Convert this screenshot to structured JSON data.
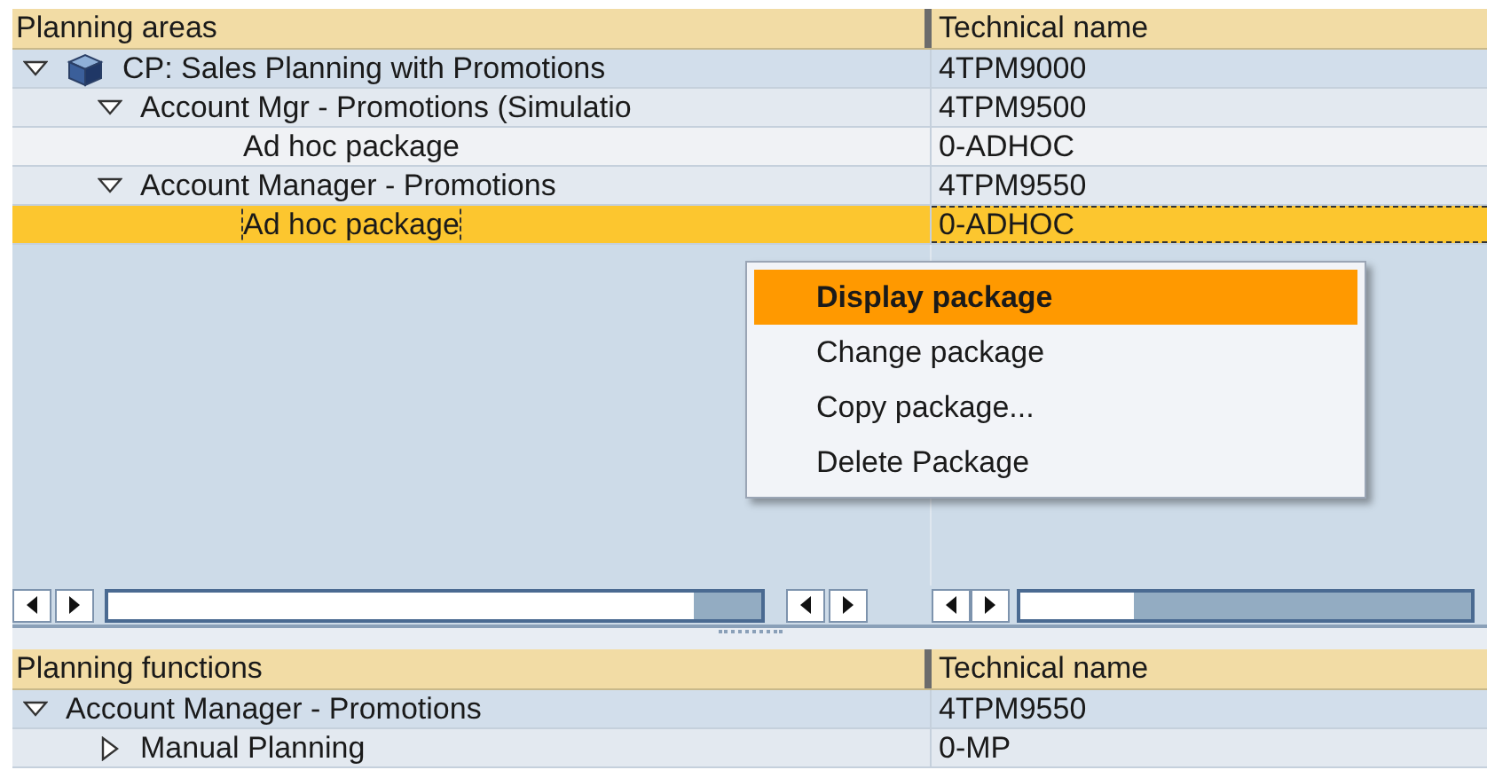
{
  "areas_table": {
    "columns": [
      "Planning areas",
      "Technical name"
    ],
    "rows": [
      {
        "kind": "area",
        "label": "CP: Sales Planning with Promotions",
        "technical_name": "4TPM9000",
        "expanded": true,
        "selected": false,
        "children": [
          {
            "kind": "level",
            "label": "Account Mgr - Promotions (Simulatio",
            "technical_name": "4TPM9500",
            "expanded": true,
            "selected": false,
            "children": [
              {
                "kind": "package",
                "label": "Ad hoc package",
                "technical_name": "0-ADHOC",
                "selected": false
              }
            ]
          },
          {
            "kind": "level",
            "label": "Account Manager - Promotions",
            "technical_name": "4TPM9550",
            "expanded": true,
            "selected": false,
            "children": [
              {
                "kind": "package",
                "label": "Ad hoc package",
                "technical_name": "0-ADHOC",
                "selected": true
              }
            ]
          }
        ]
      }
    ]
  },
  "context_menu": [
    {
      "label": "Display package",
      "selected": true
    },
    {
      "label": "Change package",
      "selected": false
    },
    {
      "label": "Copy package...",
      "selected": false
    },
    {
      "label": "Delete Package",
      "selected": false
    }
  ],
  "functions_table": {
    "columns": [
      "Planning functions",
      "Technical name"
    ],
    "rows": [
      {
        "kind": "level",
        "label": "Account Manager - Promotions",
        "technical_name": "4TPM9550",
        "expanded": true,
        "selected": false,
        "children": [
          {
            "kind": "function",
            "label": "Manual Planning",
            "technical_name": "0-MP",
            "expanded": false,
            "selected": false
          }
        ]
      }
    ]
  }
}
